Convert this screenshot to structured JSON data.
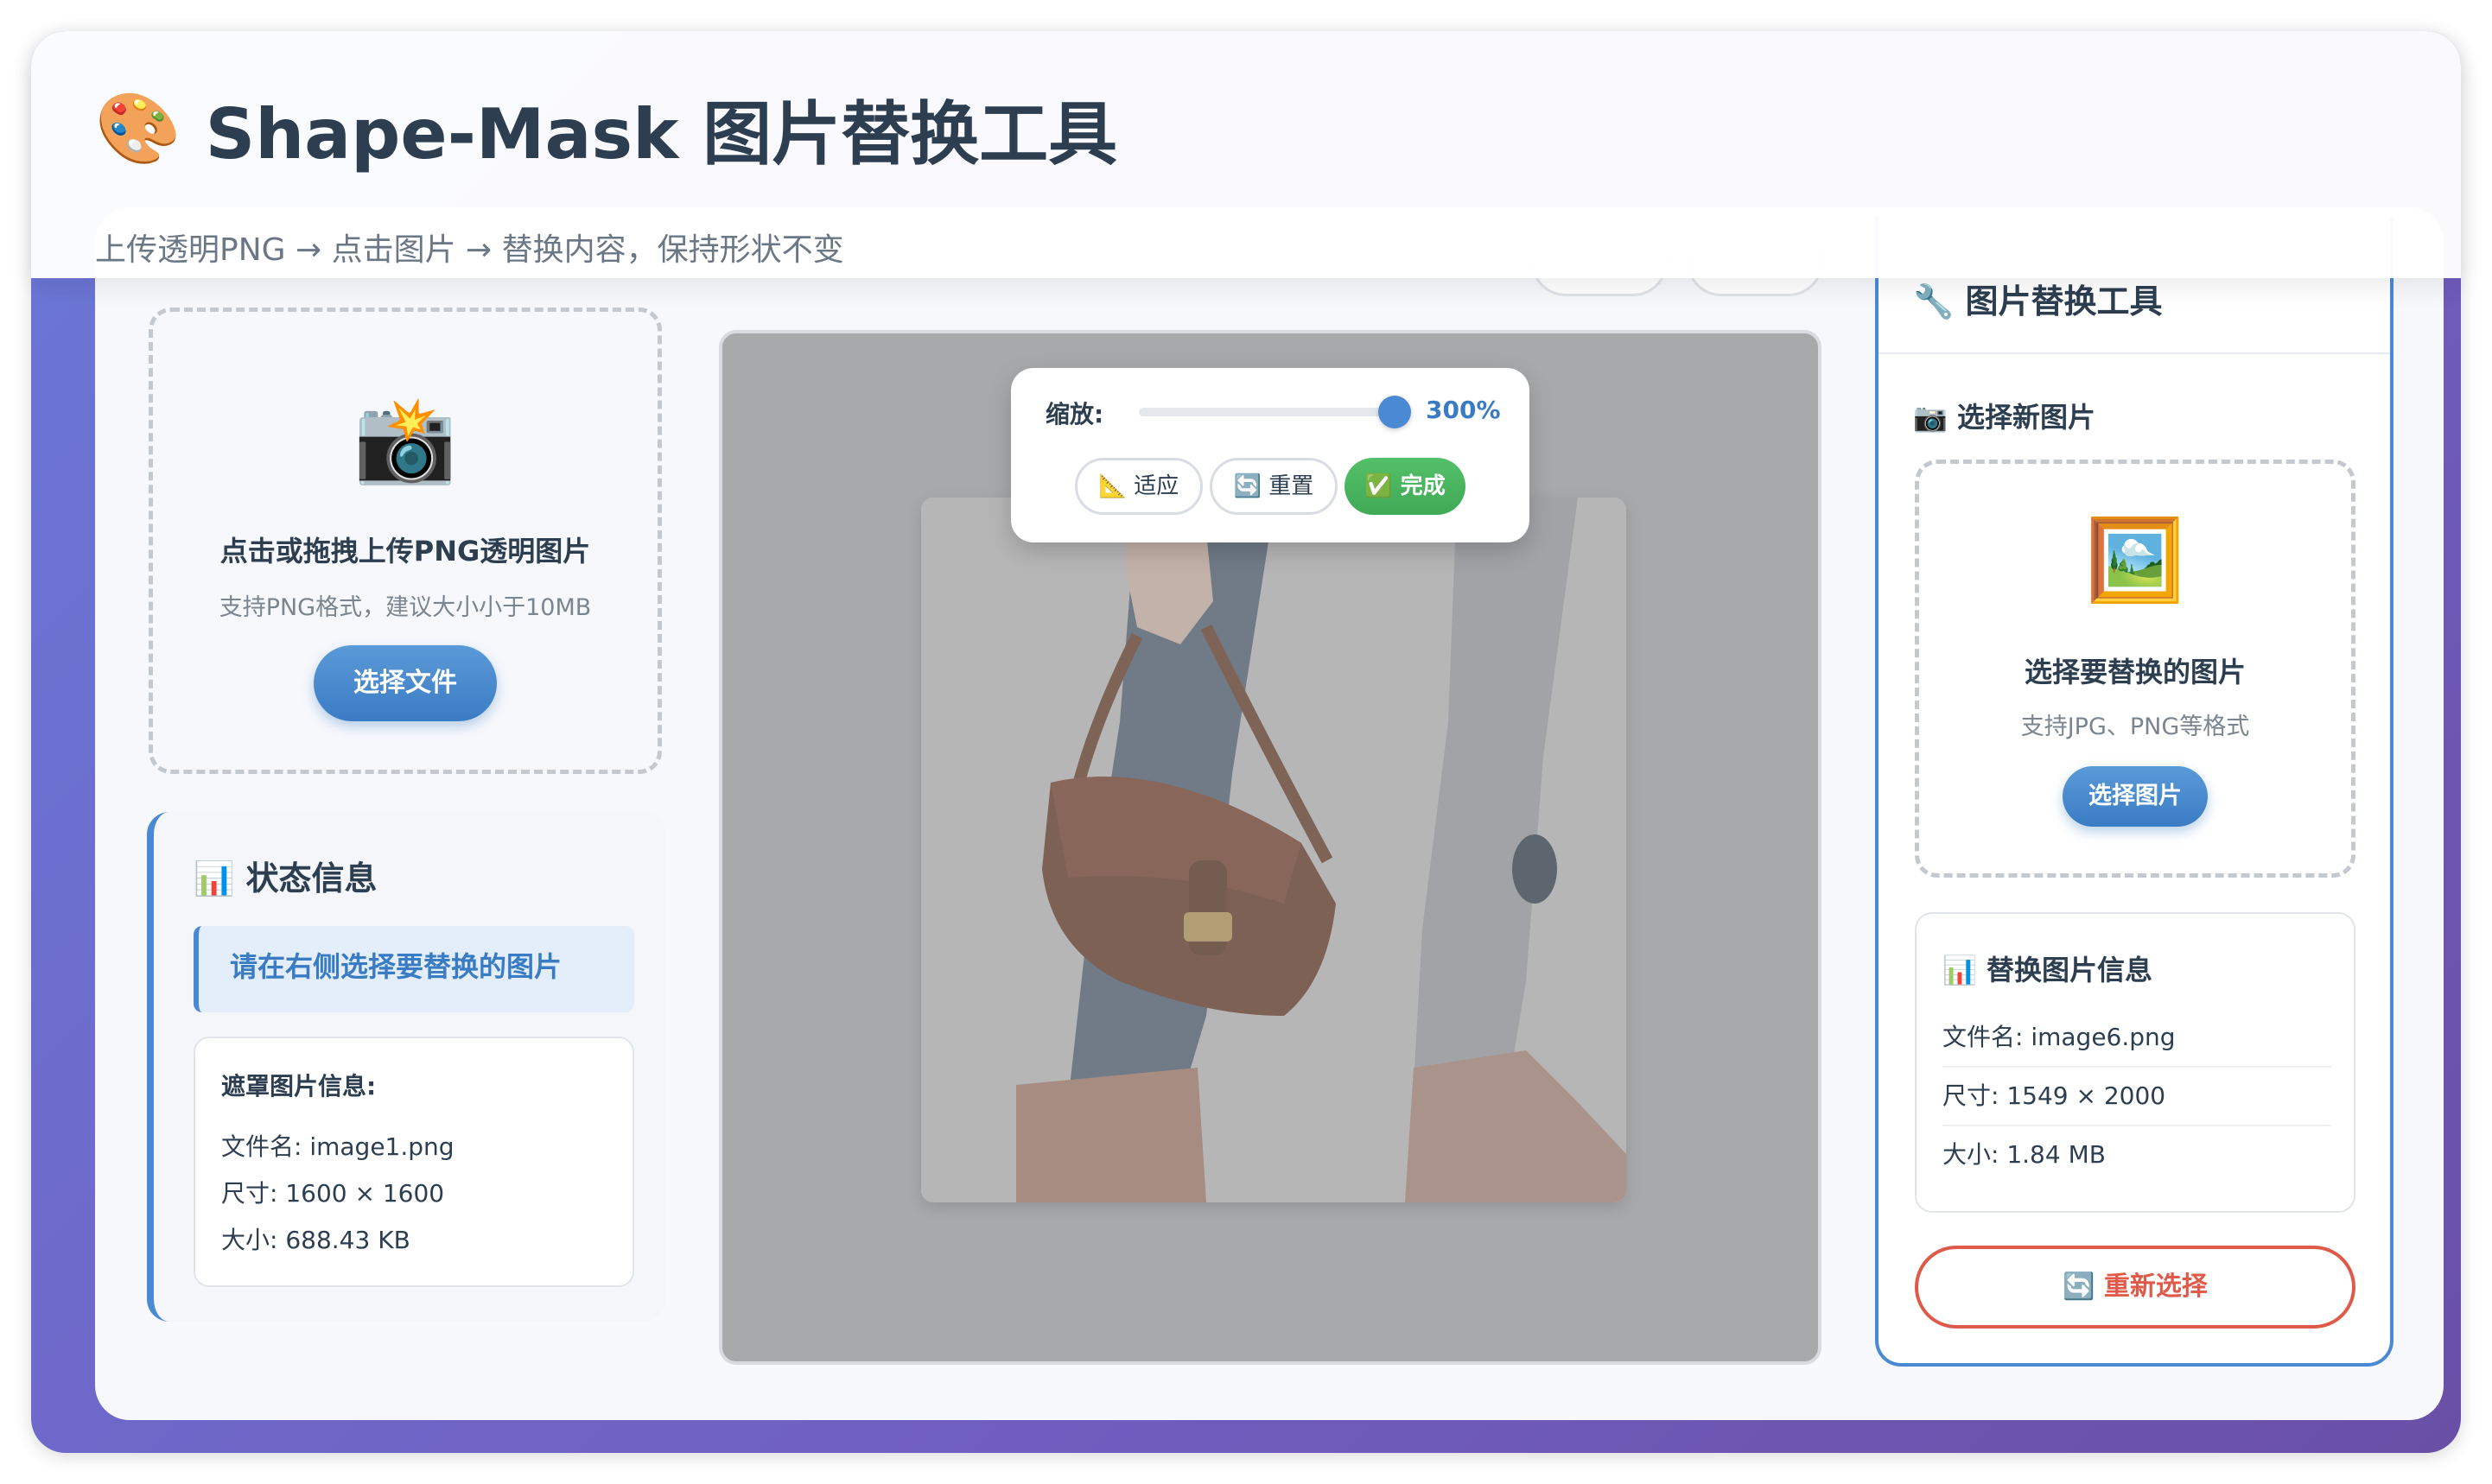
{
  "header": {
    "emoji": "🎨",
    "title": "Shape-Mask 图片替换工具",
    "subtitle": "上传透明PNG → 点击图片 → 替换内容，保持形状不变"
  },
  "upload": {
    "icon": "📸",
    "title": "点击或拖拽上传PNG透明图片",
    "hint": "支持PNG格式，建议大小小于10MB",
    "button": "选择文件"
  },
  "status": {
    "title": "📊 状态信息",
    "message": "请在右侧选择要替换的图片",
    "mask_info": {
      "heading": "遮罩图片信息:",
      "filename": "文件名: image1.png",
      "size": "尺寸: 1600 × 1600",
      "filesize": "大小: 688.43 KB"
    }
  },
  "zoom": {
    "label": "缩放:",
    "value_text": "300%",
    "fraction": 1.0,
    "buttons": {
      "fit": "📐 适应",
      "reset": "🔄 重置",
      "done": "✅ 完成"
    }
  },
  "tool": {
    "title": "🔧 图片替换工具",
    "select_heading": "📷 选择新图片",
    "choose": {
      "icon": "🖼️",
      "title": "选择要替换的图片",
      "hint": "支持JPG、PNG等格式",
      "button": "选择图片"
    },
    "replace_info": {
      "heading": "📊 替换图片信息",
      "filename": "文件名: image6.png",
      "size": "尺寸: 1549 × 2000",
      "filesize": "大小: 1.84 MB"
    },
    "reselect": "🔄 重新选择"
  },
  "colors": {
    "accent": "#4a8ad4",
    "success": "#3fa955",
    "danger": "#e05a4a",
    "frame_gradient_start": "#6a78d6",
    "frame_gradient_end": "#6a4fa6"
  }
}
